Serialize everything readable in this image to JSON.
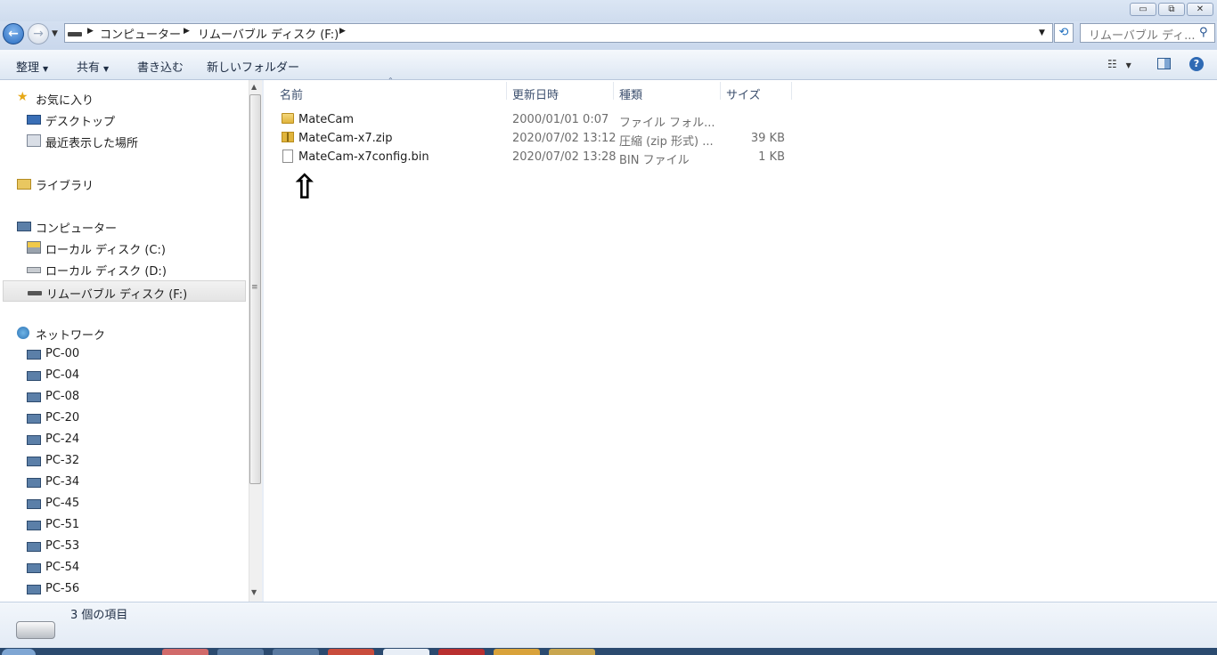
{
  "window": {
    "minimize": "▭",
    "maximize": "⧉",
    "close": "✕"
  },
  "breadcrumb": [
    "コンピューター",
    "リムーバブル ディスク (F:)"
  ],
  "search": {
    "placeholder": "リムーバブル ディ..."
  },
  "toolbar": {
    "organize": "整理",
    "share": "共有",
    "burn": "書き込む",
    "new_folder": "新しいフォルダー"
  },
  "nav": {
    "favorites": "お気に入り",
    "desktop": "デスクトップ",
    "recent": "最近表示した場所",
    "libraries": "ライブラリ",
    "computer": "コンピューター",
    "drive_c": "ローカル ディスク (C:)",
    "drive_d": "ローカル ディスク (D:)",
    "drive_f": "リムーバブル ディスク (F:)",
    "network": "ネットワーク",
    "pcs": [
      "PC-00",
      "PC-04",
      "PC-08",
      "PC-20",
      "PC-24",
      "PC-32",
      "PC-34",
      "PC-45",
      "PC-51",
      "PC-53",
      "PC-54",
      "PC-56"
    ]
  },
  "columns": {
    "name": "名前",
    "date": "更新日時",
    "type": "種類",
    "size": "サイズ"
  },
  "files": [
    {
      "name": "MateCam",
      "date": "2000/01/01 0:07",
      "type": "ファイル フォル...",
      "size": "",
      "icon": "folder-icon"
    },
    {
      "name": "MateCam-x7.zip",
      "date": "2020/07/02 13:12",
      "type": "圧縮 (zip 形式) ...",
      "size": "39 KB",
      "icon": "zip-folder-icon"
    },
    {
      "name": "MateCam-x7config.bin",
      "date": "2020/07/02 13:28",
      "type": "BIN ファイル",
      "size": "1 KB",
      "icon": "file-icon"
    }
  ],
  "annotation": {
    "arrow": "⇧"
  },
  "status": {
    "count": "3 個の項目"
  }
}
